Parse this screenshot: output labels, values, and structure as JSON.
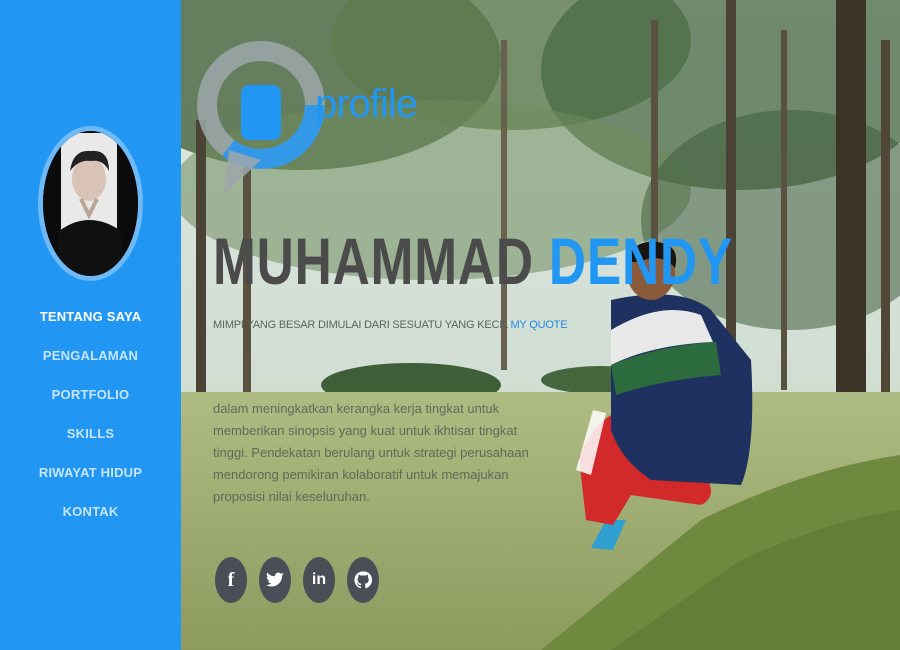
{
  "brand": {
    "logo_text": "profile"
  },
  "profile": {
    "first_name": "MUHAMMAD",
    "last_name": "DENDY",
    "quote_text": "MIMPI YANG BESAR DIMULAI DARI SESUATU YANG KECIL",
    "quote_link": "MY QUOTE",
    "description": "dalam meningkatkan kerangka kerja tingkat untuk memberikan sinopsis yang kuat untuk ikhtisar tingkat tinggi. Pendekatan berulang untuk strategi perusahaan mendorong pemikiran kolaboratif untuk memajukan proposisi nilai keseluruhan."
  },
  "nav": {
    "items": [
      {
        "label": "TENTANG SAYA",
        "active": true
      },
      {
        "label": "PENGALAMAN",
        "active": false
      },
      {
        "label": "PORTFOLIO",
        "active": false
      },
      {
        "label": "SKILLS",
        "active": false
      },
      {
        "label": "RIWAYAT HIDUP",
        "active": false
      },
      {
        "label": "KONTAK",
        "active": false
      }
    ]
  },
  "social": [
    {
      "icon": "facebook-icon",
      "glyph": "f"
    },
    {
      "icon": "twitter-icon",
      "glyph": ""
    },
    {
      "icon": "linkedin-icon",
      "glyph": "in"
    },
    {
      "icon": "github-icon",
      "glyph": ""
    }
  ],
  "colors": {
    "accent": "#2196f3",
    "sidebar": "#2196f3",
    "social_bg": "#4a4e56",
    "name_dark": "#4b4b4b"
  }
}
